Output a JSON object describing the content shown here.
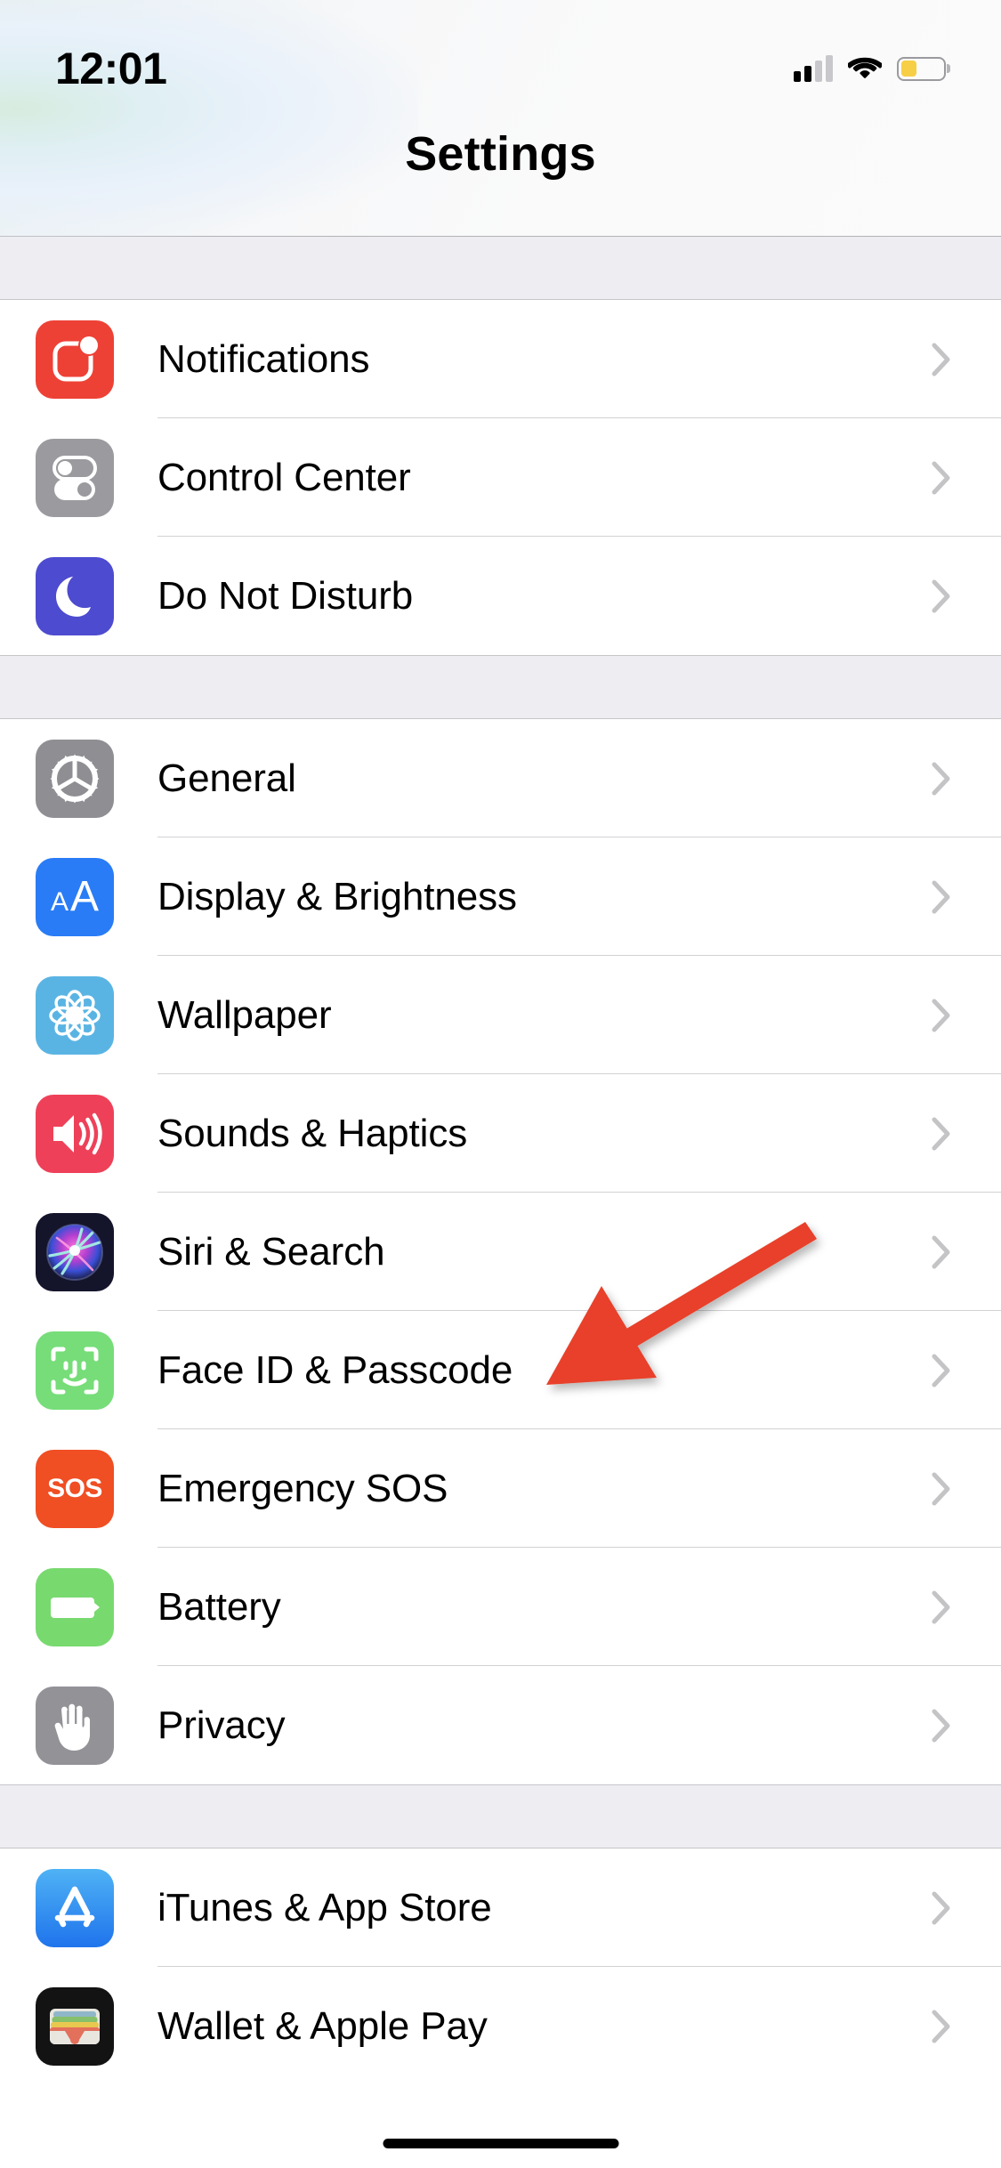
{
  "status_bar": {
    "time": "12:01",
    "cellular_bars_filled": 2,
    "cellular_bars_total": 4,
    "wifi_icon": "wifi-icon",
    "battery_icon": "battery-icon",
    "battery_level_percent": 38,
    "battery_color": "#f7cf46",
    "low_power_mode": true
  },
  "nav": {
    "title": "Settings"
  },
  "groups": [
    {
      "id": "group-alerts",
      "rows": [
        {
          "label": "Notifications",
          "icon": "notifications-icon",
          "icon_class": "ic-notifications",
          "accessory": "chevron-right-icon"
        },
        {
          "label": "Control Center",
          "icon": "control-center-icon",
          "icon_class": "ic-controlcenter",
          "accessory": "chevron-right-icon"
        },
        {
          "label": "Do Not Disturb",
          "icon": "do-not-disturb-icon",
          "icon_class": "ic-dnd",
          "accessory": "chevron-right-icon"
        }
      ]
    },
    {
      "id": "group-system",
      "rows": [
        {
          "label": "General",
          "icon": "general-gear-icon",
          "icon_class": "ic-general",
          "accessory": "chevron-right-icon"
        },
        {
          "label": "Display & Brightness",
          "icon": "display-brightness-icon",
          "icon_class": "ic-display",
          "accessory": "chevron-right-icon"
        },
        {
          "label": "Wallpaper",
          "icon": "wallpaper-icon",
          "icon_class": "ic-wallpaper",
          "accessory": "chevron-right-icon"
        },
        {
          "label": "Sounds & Haptics",
          "icon": "sounds-haptics-icon",
          "icon_class": "ic-sounds",
          "accessory": "chevron-right-icon"
        },
        {
          "label": "Siri & Search",
          "icon": "siri-search-icon",
          "icon_class": "ic-siri",
          "accessory": "chevron-right-icon"
        },
        {
          "label": "Face ID & Passcode",
          "icon": "face-id-icon",
          "icon_class": "ic-faceid",
          "accessory": "chevron-right-icon"
        },
        {
          "label": "Emergency SOS",
          "icon": "emergency-sos-icon",
          "icon_class": "ic-sos",
          "accessory": "chevron-right-icon"
        },
        {
          "label": "Battery",
          "icon": "battery-settings-icon",
          "icon_class": "ic-battery",
          "accessory": "chevron-right-icon"
        },
        {
          "label": "Privacy",
          "icon": "privacy-hand-icon",
          "icon_class": "ic-privacy",
          "accessory": "chevron-right-icon"
        }
      ]
    },
    {
      "id": "group-stores",
      "rows": [
        {
          "label": "iTunes & App Store",
          "icon": "app-store-icon",
          "icon_class": "ic-appstore",
          "accessory": "chevron-right-icon"
        },
        {
          "label": "Wallet & Apple Pay",
          "icon": "wallet-icon",
          "icon_class": "ic-wallet",
          "accessory": "chevron-right-icon"
        }
      ]
    }
  ],
  "annotation": {
    "type": "arrow",
    "color": "#e8412a",
    "points_to": "Face ID & Passcode",
    "direction": "down-left"
  },
  "icon_glyph_text": {
    "emergency_sos": "SOS",
    "display_small_a": "A",
    "display_big_a": "A"
  }
}
